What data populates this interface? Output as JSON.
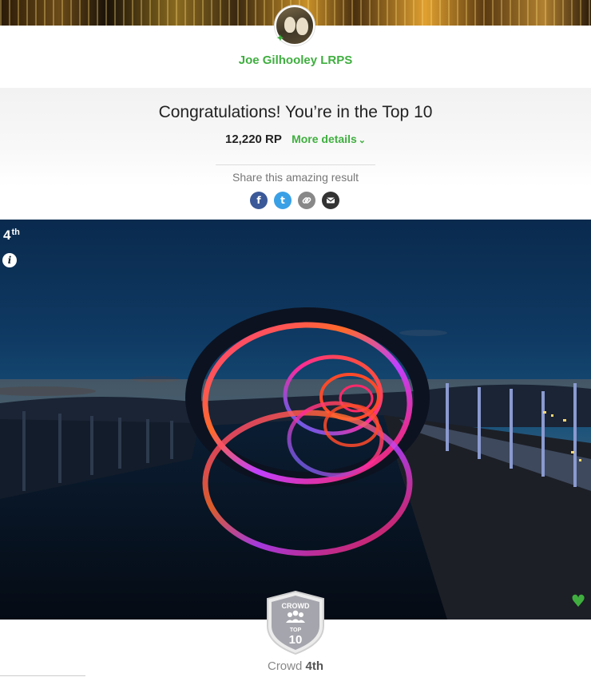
{
  "user": {
    "name": "Joe Gilhooley LRPS",
    "badge_icon": "star-badge-icon"
  },
  "result": {
    "headline": "Congratulations! You’re in the Top 10",
    "points": "12,220 RP",
    "more_details_label": "More details",
    "more_details_icon": "chevron-down-icon"
  },
  "share": {
    "label": "Share this amazing result",
    "icons": [
      "facebook-icon",
      "twitter-icon",
      "link-icon",
      "email-icon"
    ],
    "facebook_glyph": "f",
    "twitter_glyph": "t",
    "link_glyph": "🔗",
    "email_glyph": "✉"
  },
  "photo": {
    "rank_number": "4",
    "rank_suffix": "th",
    "info_glyph": "i",
    "heart_glyph": "♥"
  },
  "badge": {
    "top_text": "CROWD",
    "middle_text": "TOP",
    "number_text": "10",
    "caption_prefix": "Crowd",
    "caption_rank": "4th"
  },
  "colors": {
    "accent": "#3fae3f",
    "facebook": "#3b5998",
    "twitter": "#3aa0e6",
    "link": "#888888",
    "email": "#333333"
  }
}
